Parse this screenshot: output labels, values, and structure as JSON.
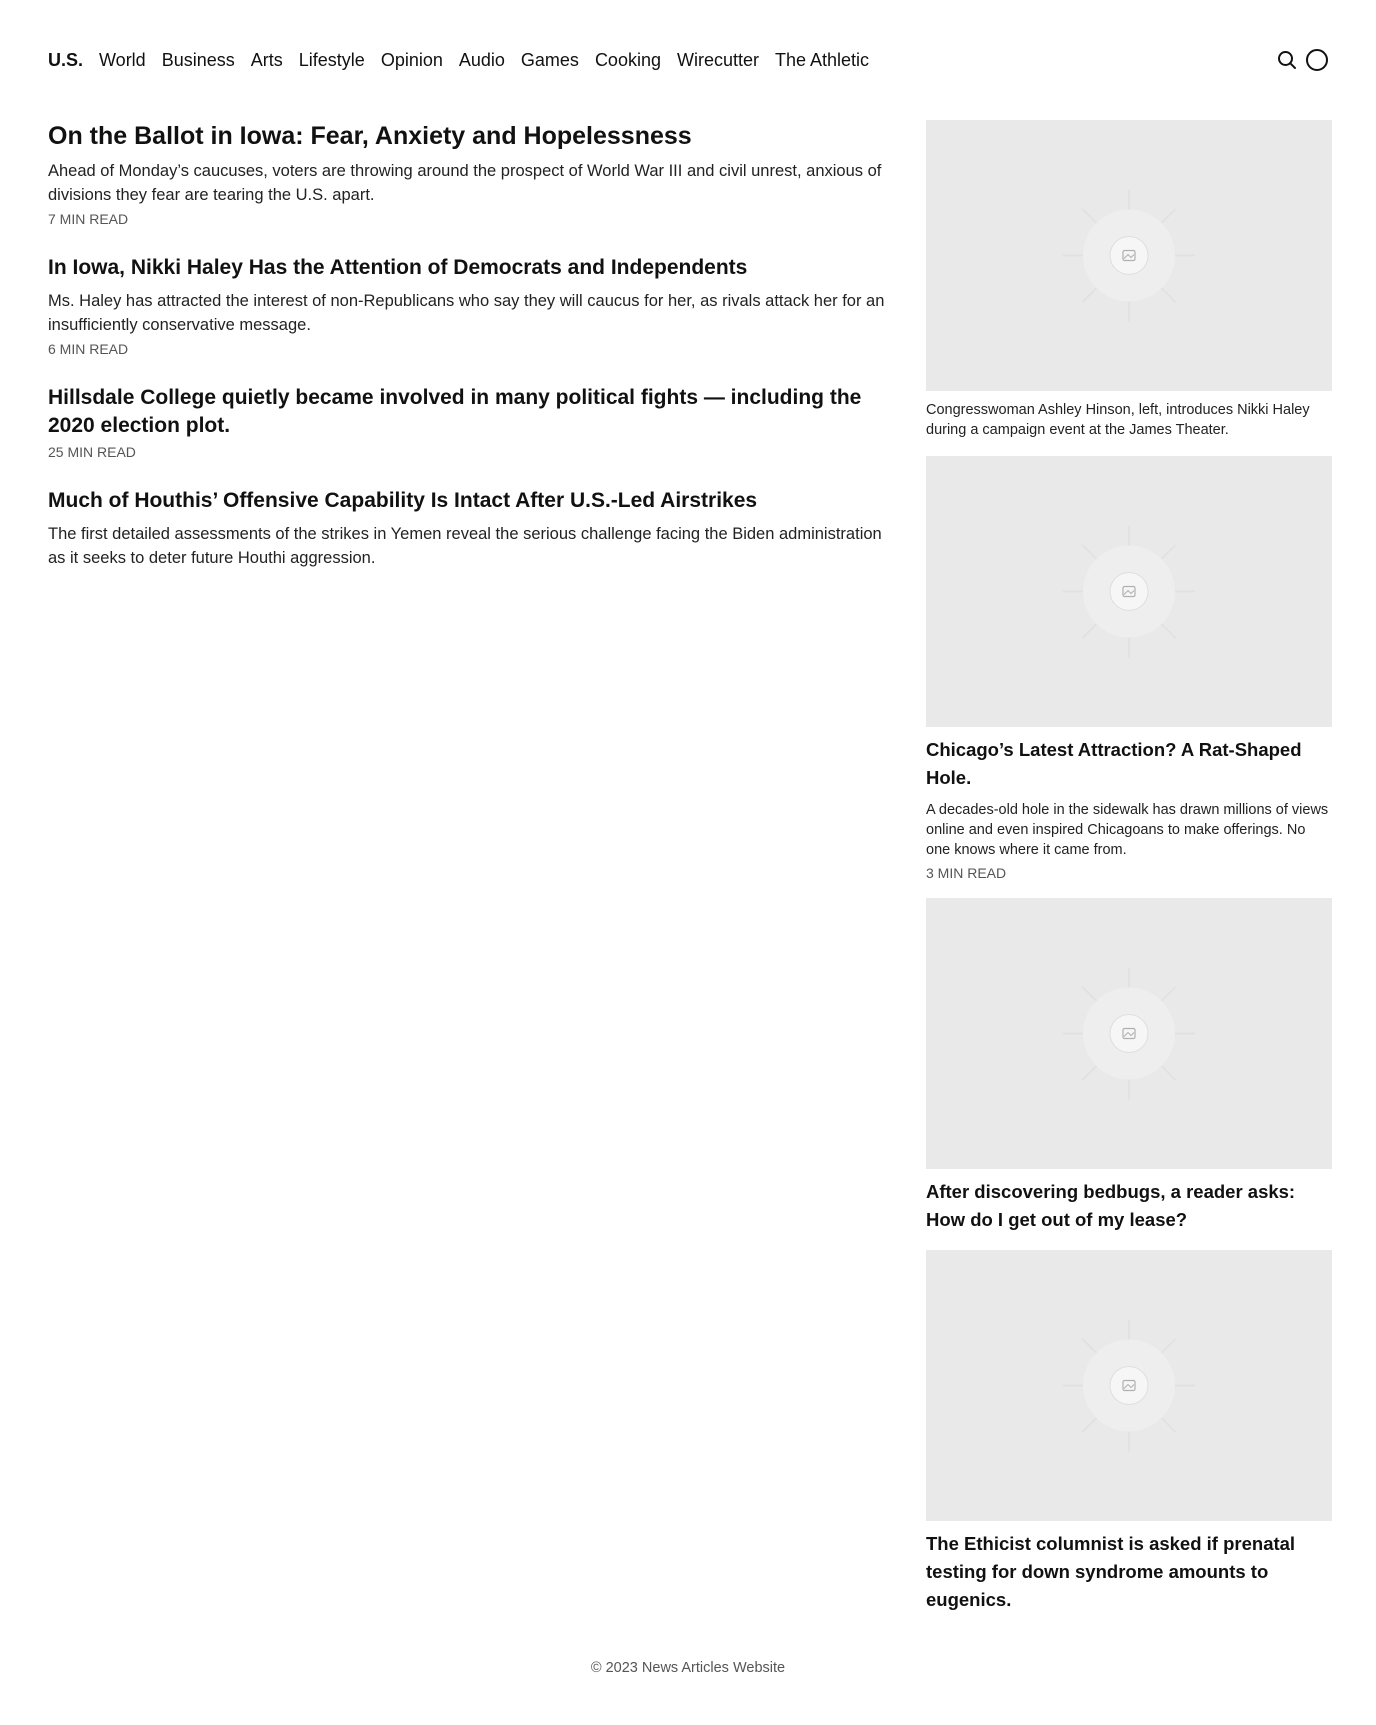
{
  "nav": {
    "items": [
      "U.S.",
      "World",
      "Business",
      "Arts",
      "Lifestyle",
      "Opinion",
      "Audio",
      "Games",
      "Cooking",
      "Wirecutter",
      "The Athletic"
    ],
    "search_icon": "search-icon",
    "account_icon": "account-circle-icon"
  },
  "main": {
    "articles": [
      {
        "headline": "On the Ballot in Iowa: Fear, Anxiety and Hopelessness",
        "summary": "Ahead of Monday’s caucuses, voters are throwing around the prospect of World War III and civil unrest, anxious of divisions they fear are tearing the U.S. apart.",
        "read_time": "7 MIN READ"
      },
      {
        "headline": "In Iowa, Nikki Haley Has the Attention of Democrats and Independents",
        "summary": "Ms. Haley has attracted the interest of non-Republicans who say they will caucus for her, as rivals attack her for an insufficiently conservative message.",
        "read_time": "6 MIN READ"
      },
      {
        "headline": "Hillsdale College quietly became involved in many political fights — including the 2020 election plot.",
        "read_time": "25 MIN READ"
      },
      {
        "headline": "Much of Houthis’ Offensive Capability Is Intact After U.S.-Led Airstrikes",
        "summary": "The first detailed assessments of the strikes in Yemen reveal the serious challenge facing the Biden administration as it seeks to deter future Houthi aggression."
      }
    ]
  },
  "side": {
    "items": [
      {
        "image_icon": "image-placeholder-icon",
        "caption": "Congresswoman Ashley Hinson, left, introduces Nikki Haley during a campaign event at the James Theater."
      },
      {
        "image_icon": "image-placeholder-icon",
        "headline": "Chicago’s Latest Attraction? A Rat-Shaped Hole.",
        "summary": "A decades-old hole in the sidewalk has drawn millions of views online and even inspired Chicagoans to make offerings. No one knows where it came from.",
        "read_time": "3 MIN READ"
      },
      {
        "image_icon": "image-placeholder-icon",
        "headline": "After discovering bedbugs, a reader asks: How do I get out of my lease?"
      },
      {
        "image_icon": "image-placeholder-icon",
        "headline": "The Ethicist columnist is asked if prenatal testing for down syndrome amounts to eugenics."
      }
    ]
  },
  "footer": {
    "text": "© 2023 News Articles Website"
  },
  "colors": {
    "text": "#111111",
    "muted": "#555555",
    "placeholder_bg": "#e9e9e9"
  }
}
